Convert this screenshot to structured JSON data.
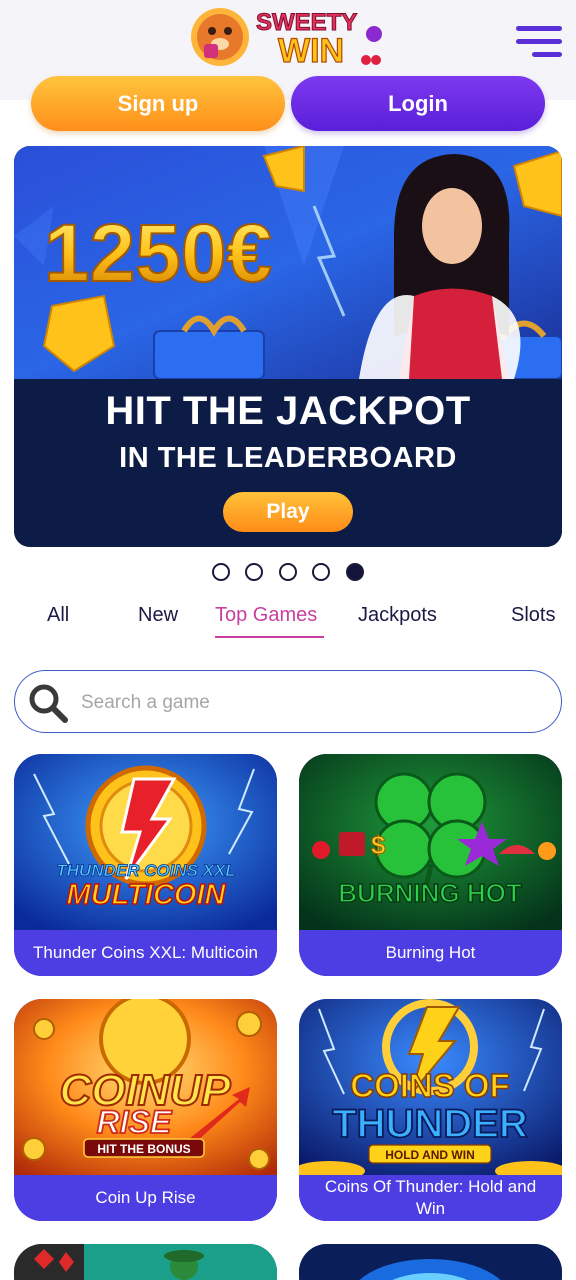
{
  "header": {
    "logo_line1": "SWEETY",
    "logo_line2": "WIN",
    "menu_icon": "hamburger-menu-icon"
  },
  "auth": {
    "signup_label": "Sign up",
    "login_label": "Login"
  },
  "banner": {
    "amount": "1250€",
    "title": "HIT THE JACKPOT",
    "subtitle": "IN THE LEADERBOARD",
    "play_label": "Play"
  },
  "carousel": {
    "slide_count": 5,
    "active_index": 4
  },
  "tabs": [
    {
      "label": "All",
      "active": false
    },
    {
      "label": "New",
      "active": false
    },
    {
      "label": "Top Games",
      "active": true
    },
    {
      "label": "Jackpots",
      "active": false
    },
    {
      "label": "Slots",
      "active": false
    }
  ],
  "search": {
    "placeholder": "Search a game",
    "icon": "search-icon"
  },
  "games": [
    {
      "name": "Thunder Coins XXL: Multicoin",
      "art_line1": "THUNDER COINS XXL",
      "art_line2": "MULTICOIN"
    },
    {
      "name": "Burning Hot",
      "art_line1": "BURNING HOT",
      "art_line2": ""
    },
    {
      "name": "Coin Up Rise",
      "art_line1": "COINUP",
      "art_line2": "RISE",
      "art_line3": "HIT THE BONUS"
    },
    {
      "name": "Coins Of Thunder: Hold and Win",
      "art_line1": "COINS OF",
      "art_line2": "THUNDER",
      "art_line3": "HOLD AND WIN"
    }
  ],
  "colors": {
    "brand_purple": "#5a1fd9",
    "brand_orange": "#ff8f1a",
    "active_tab": "#c83fa0",
    "card_label_bg": "#4d3ee3",
    "banner_bg": "#0d1b47"
  }
}
